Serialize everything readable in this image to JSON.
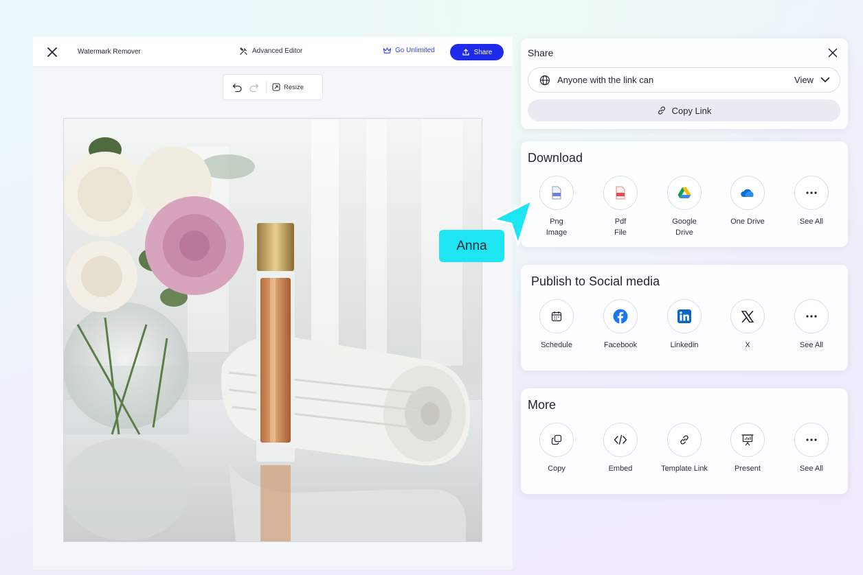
{
  "editor": {
    "title": "Watermark Remover",
    "advanced_editor": "Advanced Editor",
    "go_unlimited": "Go Unlimited",
    "share_label": "Share",
    "resize_label": "Resize"
  },
  "share_panel": {
    "title": "Share",
    "access_text": "Anyone with the link can",
    "access_role": "View",
    "copy_link": "Copy Link"
  },
  "download": {
    "title": "Download",
    "items": [
      {
        "label": "Png\nImage",
        "icon": "png-file-icon"
      },
      {
        "label": "Pdf\nFile",
        "icon": "pdf-file-icon"
      },
      {
        "label": "Google\nDrive",
        "icon": "google-drive-icon"
      },
      {
        "label": "One Drive",
        "icon": "onedrive-icon"
      },
      {
        "label": "See All",
        "icon": "more-icon"
      }
    ]
  },
  "social": {
    "title": "Publish to Social media",
    "items": [
      {
        "label": "Schedule",
        "icon": "calendar-icon"
      },
      {
        "label": "Facebook",
        "icon": "facebook-icon"
      },
      {
        "label": "Linkedin",
        "icon": "linkedin-icon"
      },
      {
        "label": "X",
        "icon": "x-logo-icon"
      },
      {
        "label": "See All",
        "icon": "more-icon"
      }
    ]
  },
  "more": {
    "title": "More",
    "items": [
      {
        "label": "Copy",
        "icon": "copy-icon"
      },
      {
        "label": "Embed",
        "icon": "code-icon"
      },
      {
        "label": "Template Link",
        "icon": "link-icon"
      },
      {
        "label": "Present",
        "icon": "presentation-icon"
      },
      {
        "label": "See All",
        "icon": "more-icon"
      }
    ]
  },
  "collaborator": {
    "name": "Anna",
    "color": "#1de5f4"
  },
  "colors": {
    "primary": "#1f2bea",
    "link": "#3742d8",
    "facebook": "#1877f2",
    "linkedin": "#0a66c2",
    "onedrive": "#0a6fd6",
    "pdf": "#e5484d"
  }
}
